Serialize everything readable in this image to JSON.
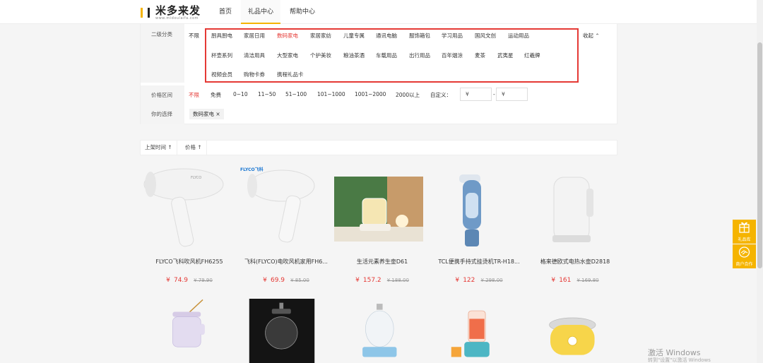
{
  "header": {
    "logo_text": "米多来发",
    "logo_subtitle": "www.midoulaifa.com",
    "nav": [
      "首页",
      "礼品中心",
      "帮助中心"
    ]
  },
  "filters": {
    "category_label": "二级分类",
    "category_all": "不限",
    "categories_row1": [
      "厨具厨电",
      "家居日用",
      "数码家电",
      "家居家纺",
      "儿童专属",
      "通讯电脑",
      "服饰箱包",
      "学习用品",
      "国风文创",
      "运动用品"
    ],
    "categories_row2": [
      "杯壶系列",
      "清洁用具",
      "大型家电",
      "个护美妆",
      "粮油茶酒",
      "车载用品",
      "出行用品",
      "百年烟涂",
      "麦茶",
      "武夷星",
      "红羲牌"
    ],
    "categories_row3": [
      "视频会员",
      "购物卡券",
      "携程礼品卡"
    ],
    "collapse": "收起",
    "price_label": "价格区间",
    "price_options": [
      "不限",
      "免费",
      "0~10",
      "11~50",
      "51~100",
      "101~1000",
      "1001~2000",
      "2000以上"
    ],
    "custom_label": "自定义：",
    "currency": "¥",
    "dash": "-",
    "selection_label": "你的选择",
    "selected_chip": "数码家电",
    "chip_close": "×"
  },
  "sort": {
    "items": [
      "上架时间",
      "价格"
    ],
    "arrow": "↑"
  },
  "products": [
    {
      "name": "FLYCO飞科吹风机FH6255",
      "currency": "¥",
      "price": "74.9",
      "old": "¥ 79.90"
    },
    {
      "name": "飞科(FLYCO)电吹风机家用FH6...",
      "currency": "¥",
      "price": "69.9",
      "old": "¥ 85.00"
    },
    {
      "name": "生活元素养生壶D61",
      "currency": "¥",
      "price": "157.2",
      "old": "¥ 188.00"
    },
    {
      "name": "TCL便携手持式挂烫机TR-H18...",
      "currency": "¥",
      "price": "122",
      "old": "¥ 298.00"
    },
    {
      "name": "格来德欧式电热水壶D2818",
      "currency": "¥",
      "price": "161",
      "old": "¥ 169.80"
    }
  ],
  "brand_label": "FLYCO飞科",
  "side": {
    "gift": "礼品库",
    "partner": "商户合作"
  },
  "watermark": {
    "line1": "激活 Windows",
    "line2": "转到\"设置\"以激活 Windows"
  },
  "colors": {
    "accent": "#f5b400",
    "highlight": "#e53935"
  }
}
